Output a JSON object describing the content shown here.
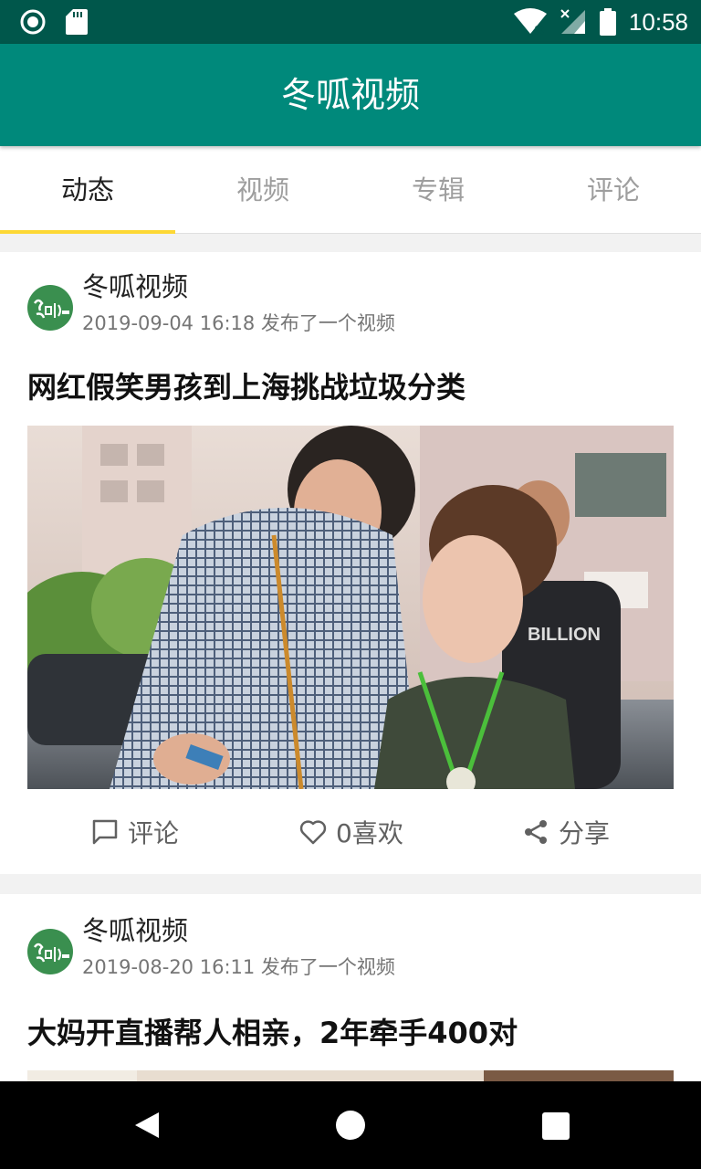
{
  "status_bar": {
    "time": "10:58",
    "icons": [
      "record-icon",
      "sd-card-icon",
      "wifi-icon",
      "signal-icon",
      "battery-icon"
    ]
  },
  "app_bar": {
    "title": "冬呱视频"
  },
  "tabs": [
    {
      "label": "动态",
      "active": true
    },
    {
      "label": "视频",
      "active": false
    },
    {
      "label": "专辑",
      "active": false
    },
    {
      "label": "评论",
      "active": false
    }
  ],
  "feed": [
    {
      "author": "冬呱视频",
      "meta": "2019-09-04 16:18 发布了一个视频",
      "title": "网红假笑男孩到上海挑战垃圾分类",
      "actions": {
        "comment": "评论",
        "like": "0喜欢",
        "share": "分享"
      }
    },
    {
      "author": "冬呱视频",
      "meta": "2019-08-20 16:11 发布了一个视频",
      "title": "大妈开直播帮人相亲，2年牵手400对"
    }
  ],
  "colors": {
    "status_bar": "#00574b",
    "app_bar": "#00897b",
    "tab_indicator": "#fdd835",
    "avatar": "#3a8f4f"
  }
}
